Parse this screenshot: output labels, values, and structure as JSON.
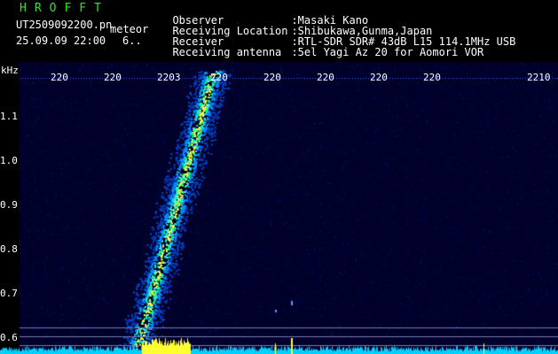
{
  "header": {
    "brand": "HROFFT",
    "file_name": "UT2509092200.pn",
    "detection_label": "meteor",
    "timestamp": "25.09.09 22:00",
    "counter": "6..",
    "info": [
      {
        "label": "Observer",
        "value": ":Masaki Kano"
      },
      {
        "label": "Receiving Location",
        "value": ":Shibukawa,Gunma,Japan"
      },
      {
        "label": "Receiver",
        "value": ":RTL-SDR SDR# 43dB L15 114.1MHz USB"
      },
      {
        "label": "Receiving antenna",
        "value": ":5el Yagi Az 20 for Aomori VOR"
      }
    ]
  },
  "axes": {
    "y_unit": "kHz",
    "y_ticks": [
      "1.1",
      "1.0",
      "0.9",
      "0.8",
      "0.7",
      "0.6"
    ],
    "x_ticks": [
      "220",
      "220",
      "2203",
      "220",
      "220",
      "220",
      "220",
      "220",
      "2210"
    ]
  },
  "colors": {
    "background": "#00002a",
    "signal_hot": "#ffff00",
    "signal_mid": "#00c8ff",
    "text_green": "#2fe02f"
  }
}
